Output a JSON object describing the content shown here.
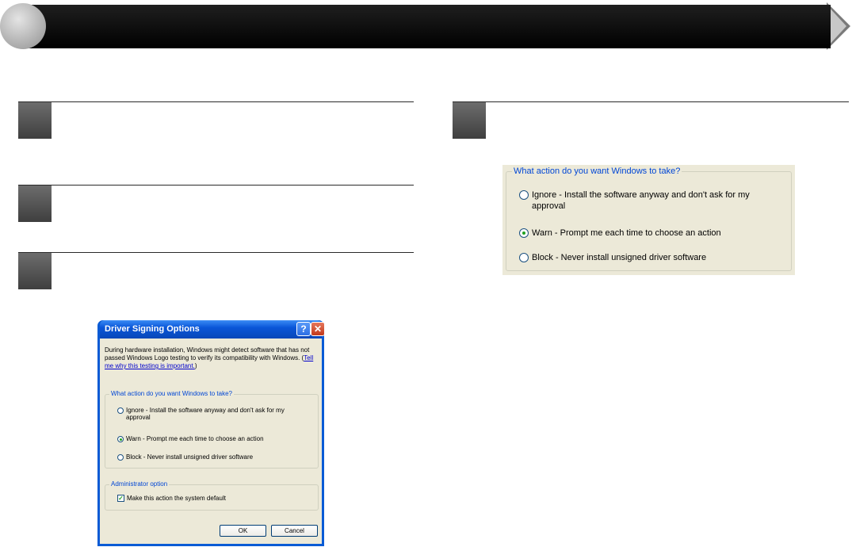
{
  "dialog": {
    "title": "Driver Signing Options",
    "help_button": "?",
    "close_button": "✕",
    "description": "During hardware installation, Windows might detect software that has not passed Windows Logo testing to verify its compatibility with Windows. (",
    "description_link": "Tell me why this testing is important.",
    "description_end": ")",
    "action_group": {
      "legend": "What action do you want Windows to take?",
      "options": [
        {
          "label": "Ignore - Install the software anyway and don't ask for my",
          "label_line2": "approval",
          "selected": false
        },
        {
          "label": "Warn - Prompt me each time to choose an action",
          "selected": true
        },
        {
          "label": "Block - Never install unsigned driver software",
          "selected": false
        }
      ]
    },
    "admin_group": {
      "legend": "Administrator option",
      "checkbox_label": "Make this action the system default",
      "checkbox_mark": "✓",
      "checked": true
    },
    "ok_label": "OK",
    "cancel_label": "Cancel"
  },
  "zoomed": {
    "legend": "What action do you want Windows to take?",
    "options": [
      {
        "label": "Ignore - Install the software anyway and don't ask for my",
        "label_line2": "approval",
        "selected": false
      },
      {
        "label": "Warn - Prompt me each time to choose an action",
        "selected": true
      },
      {
        "label": "Block - Never install unsigned driver software",
        "selected": false
      }
    ]
  },
  "colors": {
    "banner": "#000000",
    "step_box": "#4f4f4f",
    "xp_blue": "#0a5bd5",
    "dialog_face": "#ece9d8"
  },
  "icons": [
    "help-icon",
    "close-icon",
    "radio-icon",
    "checkbox-icon"
  ]
}
